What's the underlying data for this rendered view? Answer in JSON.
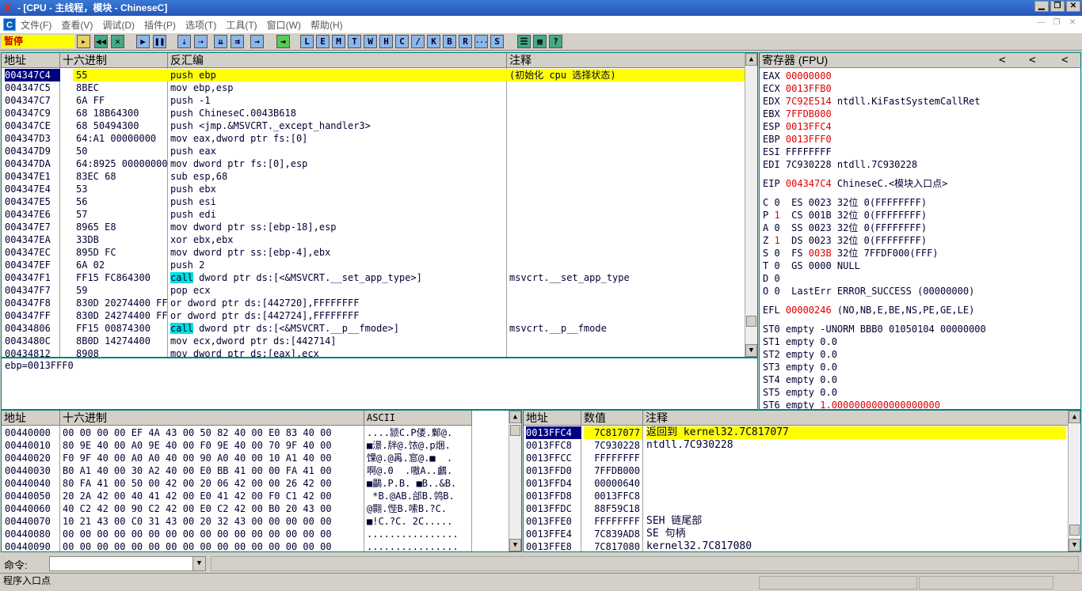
{
  "title": "- [CPU - 主线程，模块 - ChineseC]",
  "menu": [
    "文件(F)",
    "查看(V)",
    "调试(D)",
    "插件(P)",
    "选项(T)",
    "工具(T)",
    "窗口(W)",
    "帮助(H)"
  ],
  "menu_icon": "C",
  "status": "暂停",
  "toolbar_letters": [
    "L",
    "E",
    "M",
    "T",
    "W",
    "H",
    "C",
    "/",
    "K",
    "B",
    "R",
    "...",
    "S"
  ],
  "disasm": {
    "headers": [
      "地址",
      "十六进制",
      "反汇编",
      "注释"
    ],
    "rows": [
      {
        "addr": "004347C4",
        "hex": "55",
        "asm": "push ebp",
        "cmt": "(初始化 cpu 选择状态)",
        "sel": true
      },
      {
        "addr": "004347C5",
        "hex": "8BEC",
        "asm": "mov ebp,esp",
        "cmt": ""
      },
      {
        "addr": "004347C7",
        "hex": "6A FF",
        "asm": "push -1",
        "cmt": ""
      },
      {
        "addr": "004347C9",
        "hex": "68 18B64300",
        "asm": "push ChineseC.0043B618",
        "cmt": ""
      },
      {
        "addr": "004347CE",
        "hex": "68 50494300",
        "asm": "push <jmp.&MSVCRT._except_handler3>",
        "cmt": ""
      },
      {
        "addr": "004347D3",
        "hex": "64:A1 00000000",
        "asm": "mov eax,dword ptr fs:[0]",
        "cmt": ""
      },
      {
        "addr": "004347D9",
        "hex": "50",
        "asm": "push eax",
        "cmt": ""
      },
      {
        "addr": "004347DA",
        "hex": "64:8925 00000000",
        "asm": "mov dword ptr fs:[0],esp",
        "cmt": ""
      },
      {
        "addr": "004347E1",
        "hex": "83EC 68",
        "asm": "sub esp,68",
        "cmt": ""
      },
      {
        "addr": "004347E4",
        "hex": "53",
        "asm": "push ebx",
        "cmt": ""
      },
      {
        "addr": "004347E5",
        "hex": "56",
        "asm": "push esi",
        "cmt": ""
      },
      {
        "addr": "004347E6",
        "hex": "57",
        "asm": "push edi",
        "cmt": ""
      },
      {
        "addr": "004347E7",
        "hex": "8965 E8",
        "asm": "mov dword ptr ss:[ebp-18],esp",
        "cmt": ""
      },
      {
        "addr": "004347EA",
        "hex": "33DB",
        "asm": "xor ebx,ebx",
        "cmt": ""
      },
      {
        "addr": "004347EC",
        "hex": "895D FC",
        "asm": "mov dword ptr ss:[ebp-4],ebx",
        "cmt": ""
      },
      {
        "addr": "004347EF",
        "hex": "6A 02",
        "asm": "push 2",
        "cmt": ""
      },
      {
        "addr": "004347F1",
        "hex": "FF15 FC864300",
        "asmcall": "call",
        "asm": " dword ptr ds:[<&MSVCRT.__set_app_type>]",
        "cmt": "msvcrt.__set_app_type"
      },
      {
        "addr": "004347F7",
        "hex": "59",
        "asm": "pop ecx",
        "cmt": ""
      },
      {
        "addr": "004347F8",
        "hex": "830D 20274400 FF",
        "asm": "or dword ptr ds:[442720],FFFFFFFF",
        "cmt": ""
      },
      {
        "addr": "004347FF",
        "hex": "830D 24274400 FF",
        "asm": "or dword ptr ds:[442724],FFFFFFFF",
        "cmt": ""
      },
      {
        "addr": "00434806",
        "hex": "FF15 00874300",
        "asmcall": "call",
        "asm": " dword ptr ds:[<&MSVCRT.__p__fmode>]",
        "cmt": "msvcrt.__p__fmode"
      },
      {
        "addr": "0043480C",
        "hex": "8B0D 14274400",
        "asm": "mov ecx,dword ptr ds:[442714]",
        "cmt": ""
      },
      {
        "addr": "00434812",
        "hex": "8908",
        "asm": "mov dword ptr ds:[eax],ecx",
        "cmt": ""
      }
    ]
  },
  "info_line": "ebp=0013FFF0",
  "registers": {
    "header": "寄存器 (FPU)",
    "nav": [
      "<",
      "<",
      "<"
    ],
    "lines": [
      {
        "t": "EAX ",
        "v": "00000000",
        "r": ""
      },
      {
        "t": "ECX ",
        "v": "0013FFB0",
        "r": ""
      },
      {
        "t": "EDX ",
        "v": "7C92E514",
        "r": " ntdll.KiFastSystemCallRet"
      },
      {
        "t": "EBX ",
        "v": "7FFDB000",
        "r": ""
      },
      {
        "t": "ESP ",
        "v": "0013FFC4",
        "r": ""
      },
      {
        "t": "EBP ",
        "v": "0013FFF0",
        "r": ""
      },
      {
        "t": "ESI ",
        "v": "FFFFFFFF",
        "r": "",
        "plain": true
      },
      {
        "t": "EDI ",
        "v": "7C930228",
        "r": " ntdll.7C930228",
        "plain": true
      },
      {
        "gap": true
      },
      {
        "t": "EIP ",
        "v": "004347C4",
        "r": " ChineseC.<模块入口点>"
      },
      {
        "gap": true
      },
      {
        "t": "C 0  ES 0023 32位 0(FFFFFFFF)",
        "v": "",
        "r": "",
        "plain": true
      },
      {
        "t": "P ",
        "v": "1",
        "r": "  CS 001B 32位 0(FFFFFFFF)"
      },
      {
        "t": "A 0  SS 0023 32位 0(FFFFFFFF)",
        "v": "",
        "r": "",
        "plain": true
      },
      {
        "t": "Z ",
        "v": "1",
        "r": "  DS 0023 32位 0(FFFFFFFF)"
      },
      {
        "t": "S 0  FS ",
        "v": "003B",
        "r": " 32位 7FFDF000(FFF)"
      },
      {
        "t": "T 0  GS 0000 NULL",
        "v": "",
        "r": "",
        "plain": true
      },
      {
        "t": "D 0",
        "v": "",
        "r": "",
        "plain": true
      },
      {
        "t": "O 0  LastErr ERROR_SUCCESS (00000000)",
        "v": "",
        "r": "",
        "plain": true
      },
      {
        "gap": true
      },
      {
        "t": "EFL ",
        "v": "00000246",
        "r": " (NO,NB,E,BE,NS,PE,GE,LE)"
      },
      {
        "gap": true
      },
      {
        "t": "ST0 empty -UNORM BBB0 01050104 00000000",
        "v": "",
        "r": "",
        "plain": true
      },
      {
        "t": "ST1 empty 0.0",
        "v": "",
        "r": "",
        "plain": true
      },
      {
        "t": "ST2 empty 0.0",
        "v": "",
        "r": "",
        "plain": true
      },
      {
        "t": "ST3 empty 0.0",
        "v": "",
        "r": "",
        "plain": true
      },
      {
        "t": "ST4 empty 0.0",
        "v": "",
        "r": "",
        "plain": true
      },
      {
        "t": "ST5 empty 0.0",
        "v": "",
        "r": "",
        "plain": true
      },
      {
        "t": "ST6 empty ",
        "v": "1.0000000000000000000",
        "r": ""
      }
    ]
  },
  "dump": {
    "headers": [
      "地址",
      "十六进制",
      "ASCII"
    ],
    "rows": [
      {
        "addr": "00440000",
        "hex": "00 00 00 00 EF 4A 43 00 50 82 40 00 E0 83 40 00",
        "ascii": "....颕C.P偻.鄡@."
      },
      {
        "addr": "00440010",
        "hex": "80 9E 40 00 A0 9E 40 00 F0 9E 40 00 70 9F 40 00",
        "ascii": "■澋.牉@.饻@.p焑."
      },
      {
        "addr": "00440020",
        "hex": "F0 9F 40 00 A0 A0 40 00 90 A0 40 00 10 A1 40 00",
        "ascii": "馃@.@爯.悹@.■  ."
      },
      {
        "addr": "00440030",
        "hex": "B0 A1 40 00 30 A2 40 00 E0 BB 41 00 00 FA 41 00",
        "ascii": "啊@.0  .嗷A..鸕."
      },
      {
        "addr": "00440040",
        "hex": "80 FA 41 00 50 00 42 00 20 06 42 00 00 26 42 00",
        "ascii": "■鸓.P.B. ■B..&B."
      },
      {
        "addr": "00440050",
        "hex": "20 2A 42 00 40 41 42 00 E0 41 42 00 F0 C1 42 00",
        "ascii": " *B.@AB.郃B.鸰B."
      },
      {
        "addr": "00440060",
        "hex": "40 C2 42 00 90 C2 42 00 E0 C2 42 00 B0 20 43 00",
        "ascii": "@翾.悂B.嗦B.?C."
      },
      {
        "addr": "00440070",
        "hex": "10 21 43 00 C0 31 43 00 20 32 43 00 00 00 00 00",
        "ascii": "■!C.?C. 2C....."
      },
      {
        "addr": "00440080",
        "hex": "00 00 00 00 00 00 00 00 00 00 00 00 00 00 00 00",
        "ascii": "................"
      },
      {
        "addr": "00440090",
        "hex": "00 00 00 00 00 00 00 00 00 00 00 00 00 00 00 00",
        "ascii": "................"
      }
    ]
  },
  "stack": {
    "headers": [
      "地址",
      "数值",
      "注释"
    ],
    "rows": [
      {
        "addr": "0013FFC4",
        "val": "7C817077",
        "cmt": "返回到 kernel32.7C817077",
        "sel": true
      },
      {
        "addr": "0013FFC8",
        "val": "7C930228",
        "cmt": "ntdll.7C930228"
      },
      {
        "addr": "0013FFCC",
        "val": "FFFFFFFF",
        "cmt": ""
      },
      {
        "addr": "0013FFD0",
        "val": "7FFDB000",
        "cmt": ""
      },
      {
        "addr": "0013FFD4",
        "val": "00000640",
        "cmt": ""
      },
      {
        "addr": "0013FFD8",
        "val": "0013FFC8",
        "cmt": ""
      },
      {
        "addr": "0013FFDC",
        "val": "88F59C18",
        "cmt": ""
      },
      {
        "addr": "0013FFE0",
        "val": "FFFFFFFF",
        "cmt": "SEH 链尾部"
      },
      {
        "addr": "0013FFE4",
        "val": "7C839AD8",
        "cmt": "SE 句柄"
      },
      {
        "addr": "0013FFE8",
        "val": "7C817080",
        "cmt": "kernel32.7C817080"
      }
    ]
  },
  "command_label": "命令:",
  "status_text": "程序入口点"
}
